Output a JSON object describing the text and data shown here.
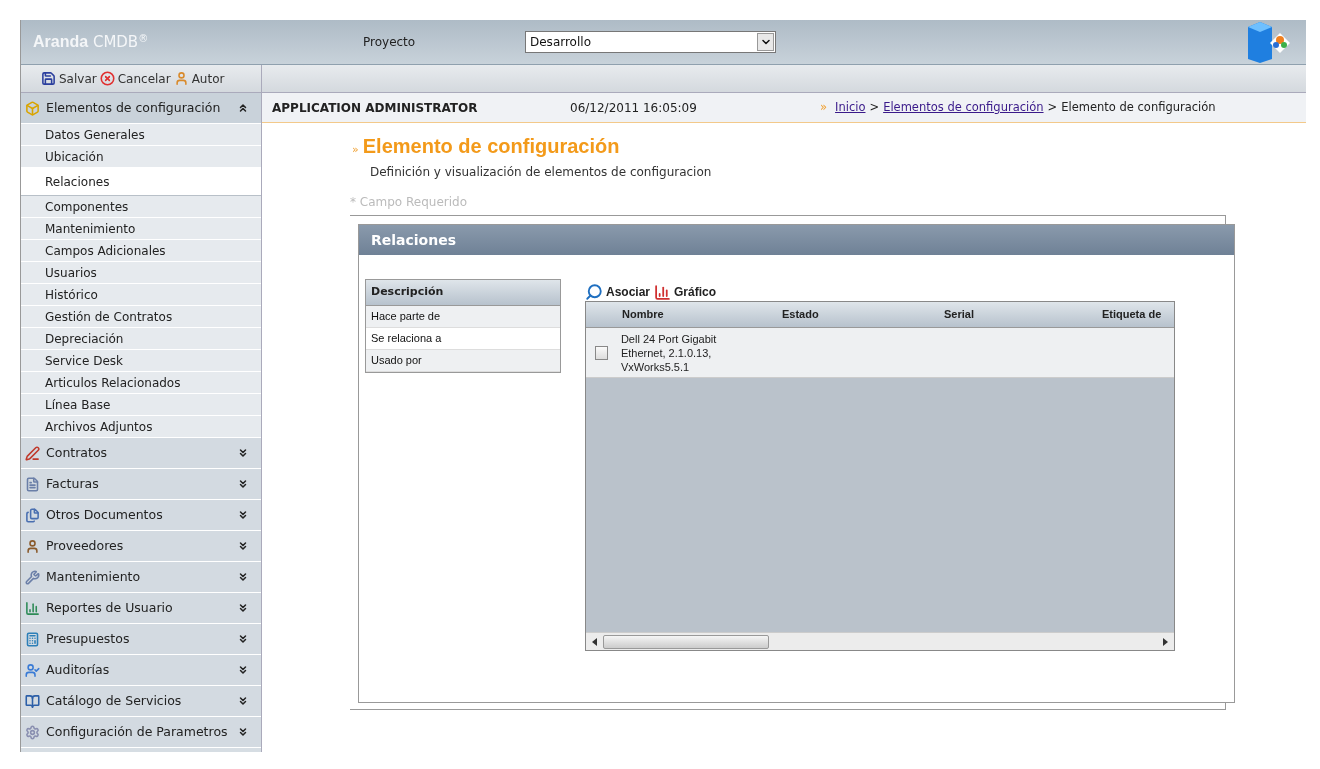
{
  "header": {
    "logo_bold": "Aranda",
    "logo_light": "CMDB",
    "logo_mark": "®",
    "project_label": "Proyecto",
    "project_value": "Desarrollo"
  },
  "toolbar": [
    "Salvar",
    "Cancelar",
    "Autor"
  ],
  "sidebar": [
    {
      "label": "Elementos de configuración",
      "expanded": true,
      "children": [
        {
          "label": "Datos Generales",
          "selected": false
        },
        {
          "label": "Ubicación",
          "selected": false
        },
        {
          "label": "Relaciones",
          "selected": true
        },
        {
          "label": "Componentes",
          "selected": false
        },
        {
          "label": "Mantenimiento",
          "selected": false
        },
        {
          "label": "Campos Adicionales",
          "selected": false
        },
        {
          "label": "Usuarios",
          "selected": false
        },
        {
          "label": "Histórico",
          "selected": false
        },
        {
          "label": "Gestión de Contratos",
          "selected": false
        },
        {
          "label": "Depreciación",
          "selected": false
        },
        {
          "label": "Service Desk",
          "selected": false
        },
        {
          "label": "Articulos Relacionados",
          "selected": false
        },
        {
          "label": "Línea Base",
          "selected": false
        },
        {
          "label": "Archivos Adjuntos",
          "selected": false
        }
      ]
    },
    {
      "label": "Contratos",
      "expanded": false
    },
    {
      "label": "Facturas",
      "expanded": false
    },
    {
      "label": "Otros Documentos",
      "expanded": false
    },
    {
      "label": "Proveedores",
      "expanded": false
    },
    {
      "label": "Mantenimiento",
      "expanded": false
    },
    {
      "label": "Reportes de Usuario",
      "expanded": false
    },
    {
      "label": "Presupuestos",
      "expanded": false
    },
    {
      "label": "Auditorías",
      "expanded": false
    },
    {
      "label": "Catálogo de Servicios",
      "expanded": false
    },
    {
      "label": "Configuración de Parametros",
      "expanded": false
    }
  ],
  "info_bar": {
    "user": "APPLICATION ADMINISTRATOR",
    "datetime": "06/12/2011 16:05:09",
    "breadcrumb_mark": "»",
    "breadcrumb": [
      {
        "label": "Inicio",
        "kind": "link"
      },
      {
        "label": ">",
        "kind": "separator"
      },
      {
        "label": "Elementos de configuración",
        "kind": "link"
      },
      {
        "label": ">",
        "kind": "separator"
      },
      {
        "label": "Elemento de configuración",
        "kind": "text"
      }
    ]
  },
  "page": {
    "title_mark": "»",
    "title": "Elemento de configuración",
    "subtitle": "Definición y visualización de elementos de configuracion",
    "required_note": "* Campo Requerido"
  },
  "panel": {
    "title": "Relaciones",
    "relation_types": {
      "header": "Descripción",
      "items": [
        {
          "label": "Hace parte de",
          "selected": false
        },
        {
          "label": "Se relaciona a",
          "selected": true
        },
        {
          "label": "Usado por",
          "selected": false
        }
      ]
    },
    "actions": [
      "Asociar",
      "Gráfico"
    ],
    "table": {
      "columns": [
        "Nombre",
        "Estado",
        "Serial",
        "Etiqueta de"
      ],
      "rows": [
        {
          "checked": false,
          "cells": [
            "Dell 24 Port Gigabit Ethernet, 2.1.0.13, VxWorks5.5.1",
            "",
            "",
            ""
          ]
        }
      ]
    }
  }
}
